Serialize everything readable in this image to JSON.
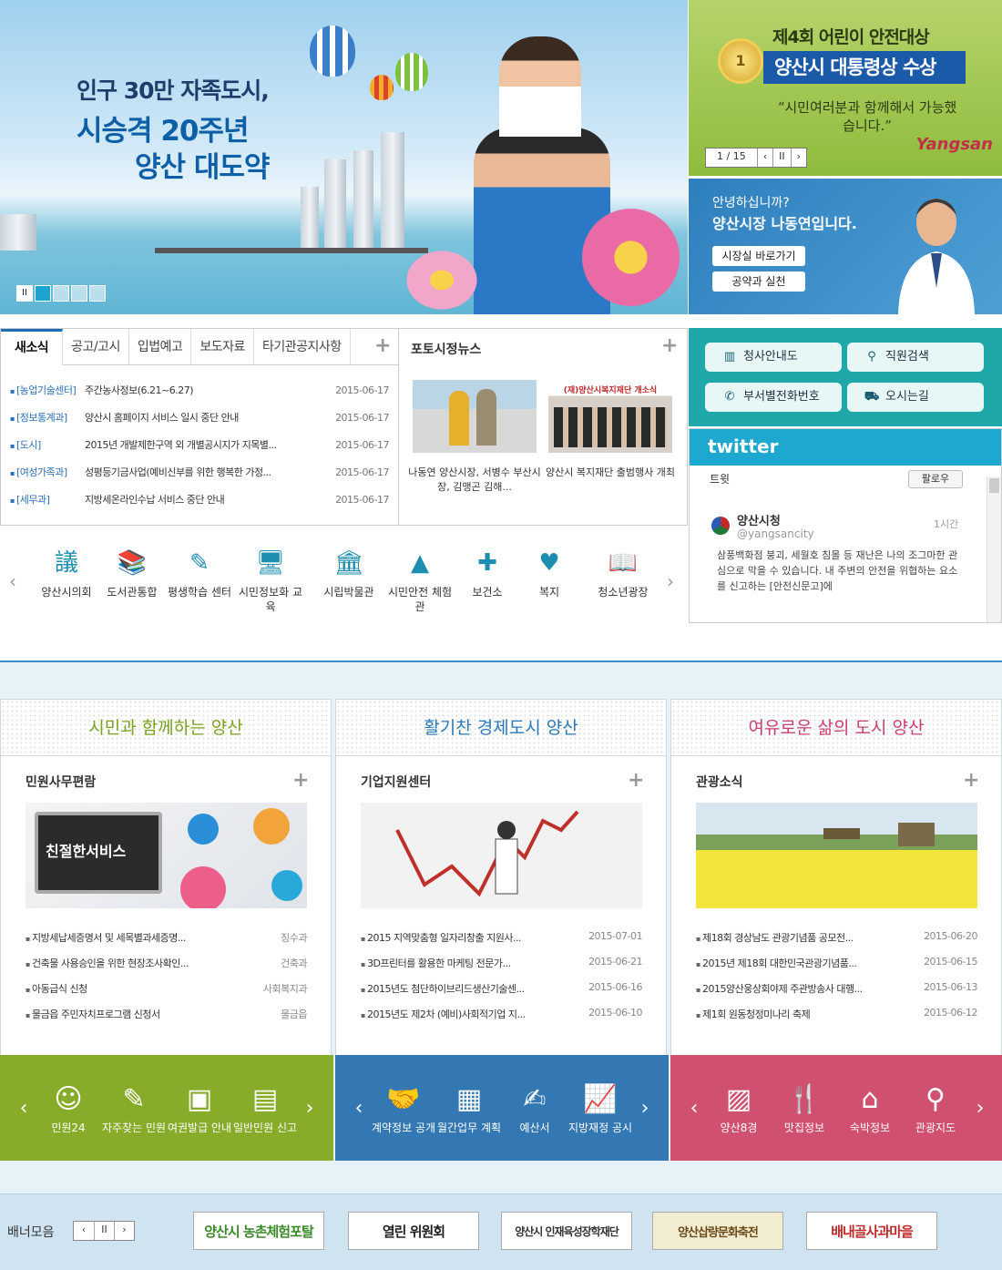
{
  "hero": {
    "line1": "인구 30만 자족도시,",
    "line2": "시승격 20주년",
    "line3": "양산 대도약",
    "pause_label": "II"
  },
  "award": {
    "title": "제4회 어린이 안전대상",
    "headline": "양산시 대통령상 수상",
    "quote": "“시민여러분과 함께해서 가능했습니다.”",
    "medal": "1",
    "pager": [
      "1 / 15",
      "‹",
      "II",
      "›"
    ],
    "logo": "Yangsan"
  },
  "mayor": {
    "greeting": "안녕하십니까?",
    "name_line": "양산시장 나동연입니다.",
    "btn1": "시장실 바로가기",
    "btn2": "공약과 실천"
  },
  "news": {
    "tabs": [
      "새소식",
      "공고/고시",
      "입법예고",
      "보도자료",
      "타기관공지사항"
    ],
    "rows": [
      {
        "cat": "[농업기술센터]",
        "title": "주간농사정보(6.21~6.27)",
        "date": "2015-06-17"
      },
      {
        "cat": "[정보통계과]",
        "title": "양산시 홈페이지 서비스 일시 중단 안내",
        "date": "2015-06-17"
      },
      {
        "cat": "[도시]",
        "title": "2015년 개발제한구역 외 개별공시지가 지목별...",
        "date": "2015-06-17"
      },
      {
        "cat": "[여성가족과]",
        "title": "성평등기금사업(예비신부를 위한 행복한 가정...",
        "date": "2015-06-17"
      },
      {
        "cat": "[세무과]",
        "title": "지방세온라인수납 서비스 중단 안내",
        "date": "2015-06-17"
      }
    ]
  },
  "photo": {
    "title": "포토시정뉴스",
    "items": [
      {
        "caption": "나동연 양산시장, 서병수 부산시장, 김맹곤 김해..."
      },
      {
        "caption": "양산시 복지재단 출범행사 개최",
        "sign": "(재)양산시복지재단 개소식"
      }
    ]
  },
  "quick": [
    "청사안내도",
    "직원검색",
    "부서별전화번호",
    "오시는길"
  ],
  "twitter": {
    "logo": "twitter",
    "tab": "트윗",
    "follow": "팔로우",
    "name": "양산시청",
    "handle": "@yangsancity",
    "time": "1시간",
    "body": "삼풍백화점 붕괴, 세월호 침몰 등 재난은 나의 조그마한 관심으로 막을 수 있습니다. 내 주변의 안전을 위협하는 요소를 신고하는 [안전신문고]에"
  },
  "icons": [
    {
      "label": "양산시의회",
      "glyph": "議"
    },
    {
      "label": "도서관통합",
      "glyph": "📚"
    },
    {
      "label": "평생학습 센터",
      "glyph": "✎"
    },
    {
      "label": "시민정보화 교육",
      "glyph": "🖥"
    },
    {
      "label": "시립박물관",
      "glyph": "🏛"
    },
    {
      "label": "시민안전 체험관",
      "glyph": "▲"
    },
    {
      "label": "보건소",
      "glyph": "✚"
    },
    {
      "label": "복지",
      "glyph": "♥"
    },
    {
      "label": "청소년광장",
      "glyph": "📖"
    }
  ],
  "columns": [
    {
      "slogan": "시민과 함께하는 양산",
      "slogan_color": "#7aa21e",
      "title": "민원사무편람",
      "img_text": "친절한서비스",
      "rows": [
        {
          "t": "지방세납세증명서 및 세목별과세증명...",
          "r": "징수과"
        },
        {
          "t": "건축물 사용승인을 위한 현장조사확인...",
          "r": "건축과"
        },
        {
          "t": "아동급식 신청",
          "r": "사회복지과"
        },
        {
          "t": "물금읍 주민자치프로그램 신청서",
          "r": "물금읍"
        }
      ],
      "foot_color": "#86ac2a",
      "foot": [
        {
          "label": "민원24",
          "glyph": "☺"
        },
        {
          "label": "자주찾는 민원",
          "glyph": "✎"
        },
        {
          "label": "여권발급 안내",
          "glyph": "▣"
        },
        {
          "label": "일반민원 신고",
          "glyph": "▤"
        }
      ]
    },
    {
      "slogan": "활기찬 경제도시 양산",
      "slogan_color": "#2a78b8",
      "title": "기업지원센터",
      "rows": [
        {
          "t": "2015 지역맞춤형 일자리창출 지원사...",
          "r": "2015-07-01"
        },
        {
          "t": "3D프린터를 활용한 마케팅 전문가...",
          "r": "2015-06-21"
        },
        {
          "t": "2015년도 첨단하이브리드생산기술센...",
          "r": "2015-06-16"
        },
        {
          "t": "2015년도 제2차 (예비)사회적기업 지...",
          "r": "2015-06-10"
        }
      ],
      "foot_color": "#3377b3",
      "foot": [
        {
          "label": "계약정보 공개",
          "glyph": "🤝"
        },
        {
          "label": "월간업무 계획",
          "glyph": "▦"
        },
        {
          "label": "예산서",
          "glyph": "✍"
        },
        {
          "label": "지방재정 공시",
          "glyph": "📈"
        }
      ]
    },
    {
      "slogan": "여유로운 삶의 도시 양산",
      "slogan_color": "#c9406e",
      "title": "관광소식",
      "rows": [
        {
          "t": "제18회 경상남도 관광기념품 공모전...",
          "r": "2015-06-20"
        },
        {
          "t": "2015년 제18회 대한민국관광기념품...",
          "r": "2015-06-15"
        },
        {
          "t": "2015양산웅상회야제 주관방송사 대행...",
          "r": "2015-06-13"
        },
        {
          "t": "제1회 원동청정미나리 축제",
          "r": "2015-06-12"
        }
      ],
      "foot_color": "#d0506f",
      "foot": [
        {
          "label": "양산8경",
          "glyph": "▨"
        },
        {
          "label": "맛집정보",
          "glyph": "🍴"
        },
        {
          "label": "숙박정보",
          "glyph": "⌂"
        },
        {
          "label": "관광지도",
          "glyph": "⚲"
        }
      ]
    }
  ],
  "banner": {
    "label": "배너모음",
    "pager": [
      "‹",
      "II",
      "›"
    ],
    "items": [
      {
        "text": "양산시 농촌체험포탈",
        "color": "#3a8a2a"
      },
      {
        "text": "열린 위원회",
        "color": "#222"
      },
      {
        "text": "양산시 인재육성장학재단",
        "color": "#333"
      },
      {
        "text": "양산삽량문화축전",
        "color": "#6a4a1a"
      },
      {
        "text": "배내골사과마을",
        "color": "#c02a2a"
      }
    ]
  }
}
